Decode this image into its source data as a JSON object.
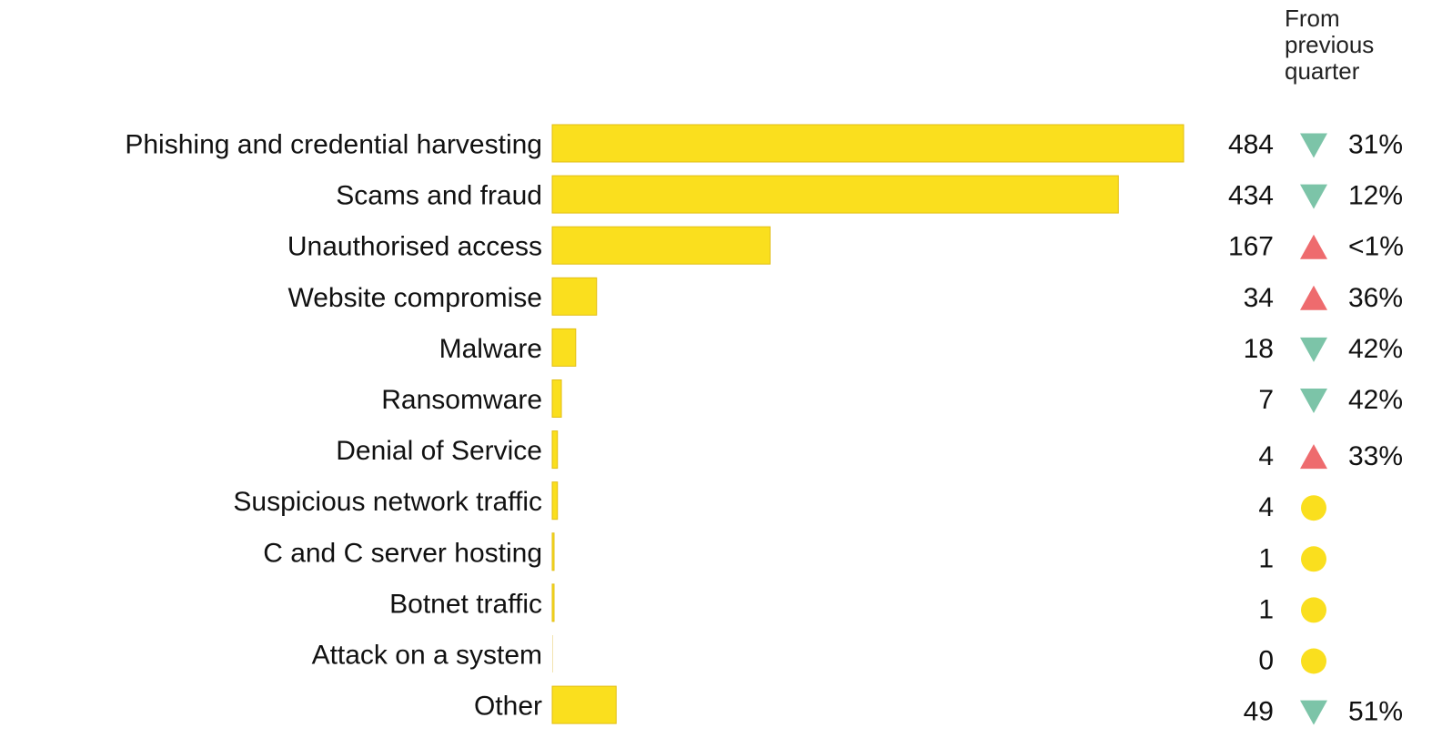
{
  "chart_data": {
    "type": "bar",
    "orientation": "horizontal",
    "title": "",
    "xlabel": "",
    "ylabel": "",
    "change_header": "From previous quarter",
    "categories": [
      "Phishing and credential harvesting",
      "Scams and fraud",
      "Unauthorised access",
      "Website compromise",
      "Malware",
      "Ransomware",
      "Denial of Service",
      "Suspicious network traffic",
      "C and C server hosting",
      "Botnet traffic",
      "Attack on a system",
      "Other"
    ],
    "values": [
      484,
      434,
      167,
      34,
      18,
      7,
      4,
      4,
      1,
      1,
      0,
      49
    ],
    "changes": [
      {
        "direction": "down",
        "label": "31%"
      },
      {
        "direction": "down",
        "label": "12%"
      },
      {
        "direction": "up",
        "label": "<1%"
      },
      {
        "direction": "up",
        "label": "36%"
      },
      {
        "direction": "down",
        "label": "42%"
      },
      {
        "direction": "down",
        "label": "42%"
      },
      {
        "direction": "up",
        "label": "33%"
      },
      {
        "direction": "none",
        "label": ""
      },
      {
        "direction": "none",
        "label": ""
      },
      {
        "direction": "none",
        "label": ""
      },
      {
        "direction": "none",
        "label": ""
      },
      {
        "direction": "down",
        "label": "51%"
      }
    ],
    "xlim": [
      0,
      484
    ],
    "grid": false,
    "colors": {
      "bar": "#FADF1E",
      "bar_edge": "#E2BE14",
      "down": "#7CC4A8",
      "up": "#EE6B6E",
      "none": "#FADF1E"
    }
  }
}
